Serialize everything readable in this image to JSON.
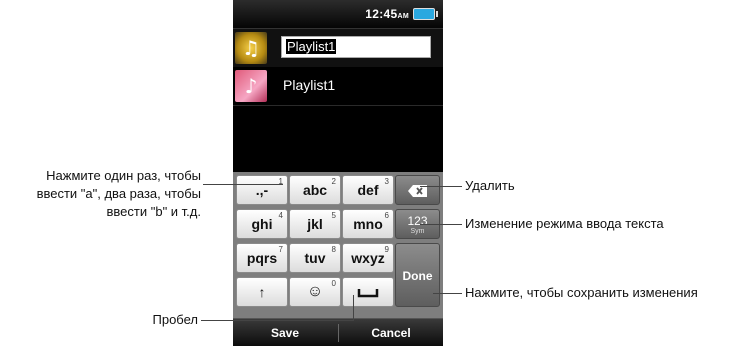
{
  "status": {
    "time": "12:45",
    "time_suffix": "AM"
  },
  "playlists": {
    "edit_value": "Playlist1",
    "items": [
      {
        "label": "Playlist1"
      }
    ]
  },
  "keyboard": {
    "row1": [
      {
        "label": ".,-",
        "num": "1"
      },
      {
        "label": "abc",
        "num": "2"
      },
      {
        "label": "def",
        "num": "3"
      }
    ],
    "row2": [
      {
        "label": "ghi",
        "num": "4"
      },
      {
        "label": "jkl",
        "num": "5"
      },
      {
        "label": "mno",
        "num": "6"
      }
    ],
    "row3": [
      {
        "label": "pqrs",
        "num": "7"
      },
      {
        "label": "tuv",
        "num": "8"
      },
      {
        "label": "wxyz",
        "num": "9"
      }
    ],
    "row4": [
      {
        "label": "↑",
        "num": ""
      },
      {
        "label": "☺",
        "num": "0"
      },
      {
        "label": "␣",
        "num": ""
      }
    ],
    "delete_icon": "backspace-icon",
    "mode_label": "123",
    "mode_sub": "Sym",
    "done_label": "Done"
  },
  "softkeys": {
    "left": "Save",
    "right": "Cancel"
  },
  "callouts": {
    "keypress_line1": "Нажмите один раз, чтобы",
    "keypress_line2": "ввести \"a\", два раза, чтобы",
    "keypress_line3": "ввести \"b\" и т.д.",
    "space": "Пробел",
    "delete": "Удалить",
    "mode": "Изменение режима ввода текста",
    "done": "Нажмите, чтобы сохранить изменения"
  }
}
